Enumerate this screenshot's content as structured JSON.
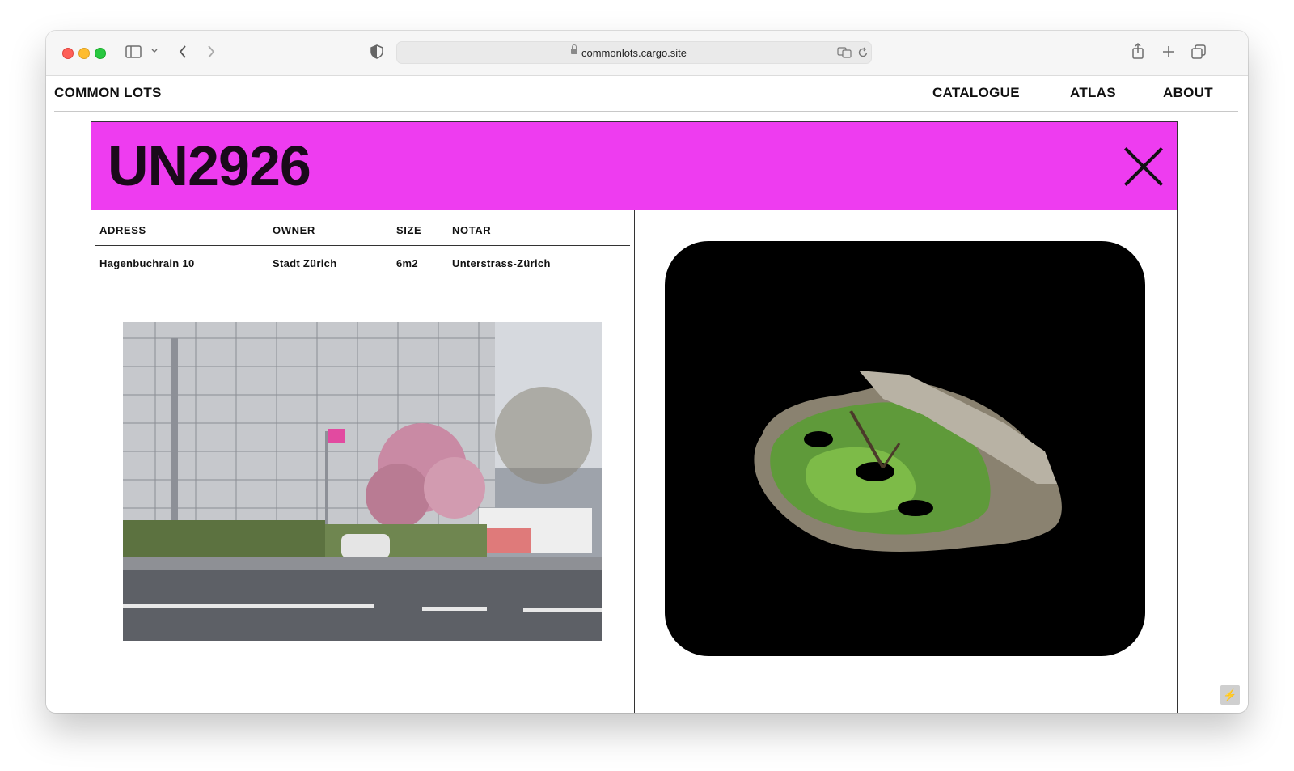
{
  "browser": {
    "url": "commonlots.cargo.site"
  },
  "site": {
    "title": "COMMON LOTS",
    "nav": [
      "CATALOGUE",
      "ATLAS",
      "ABOUT"
    ]
  },
  "lot": {
    "id": "UN2926",
    "accent_color": "#ee3cf0",
    "headers": {
      "adress": "ADRESS",
      "owner": "OWNER",
      "size": "SIZE",
      "notar": "NOTAR"
    },
    "values": {
      "adress": "Hagenbuchrain 10",
      "owner": "Stadt Zürich",
      "size": "6m2",
      "notar": "Unterstrass-Zürich"
    }
  },
  "icons": {
    "close": "close-icon",
    "lightning": "lightning-icon"
  }
}
